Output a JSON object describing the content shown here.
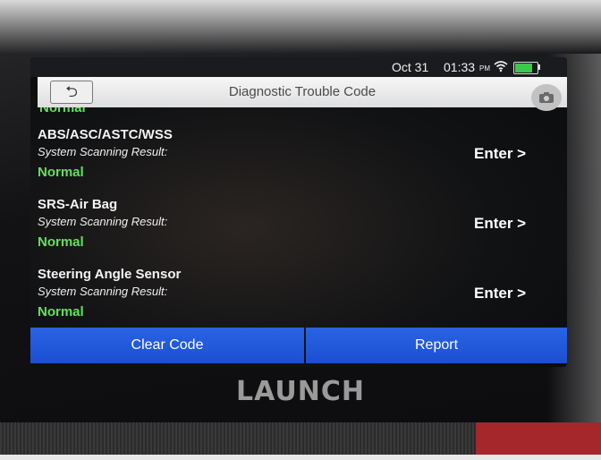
{
  "status_bar": {
    "date": "Oct 31",
    "time": "01:33",
    "ampm": "PM",
    "wifi_icon": "wifi-icon",
    "battery_level": 0.8,
    "battery_color": "#3cc84a"
  },
  "header": {
    "back_icon": "⮌",
    "title": "Diagnostic Trouble Code",
    "camera_icon": "◉"
  },
  "list": {
    "partial_result": "Normal",
    "items": [
      {
        "name": "ABS/ASC/ASTC/WSS",
        "scan_label": "System Scanning Result:",
        "result": "Normal",
        "enter_label": "Enter >"
      },
      {
        "name": "SRS-Air Bag",
        "scan_label": "System Scanning Result:",
        "result": "Normal",
        "enter_label": "Enter >"
      },
      {
        "name": "Steering Angle Sensor",
        "scan_label": "System Scanning Result:",
        "result": "Normal",
        "enter_label": "Enter >"
      }
    ],
    "result_color": "#63e05d"
  },
  "bottom_bar": {
    "clear_code_label": "Clear Code",
    "report_label": "Report",
    "accent": "#1f56d8"
  },
  "device": {
    "brand": "LAUNCH"
  }
}
